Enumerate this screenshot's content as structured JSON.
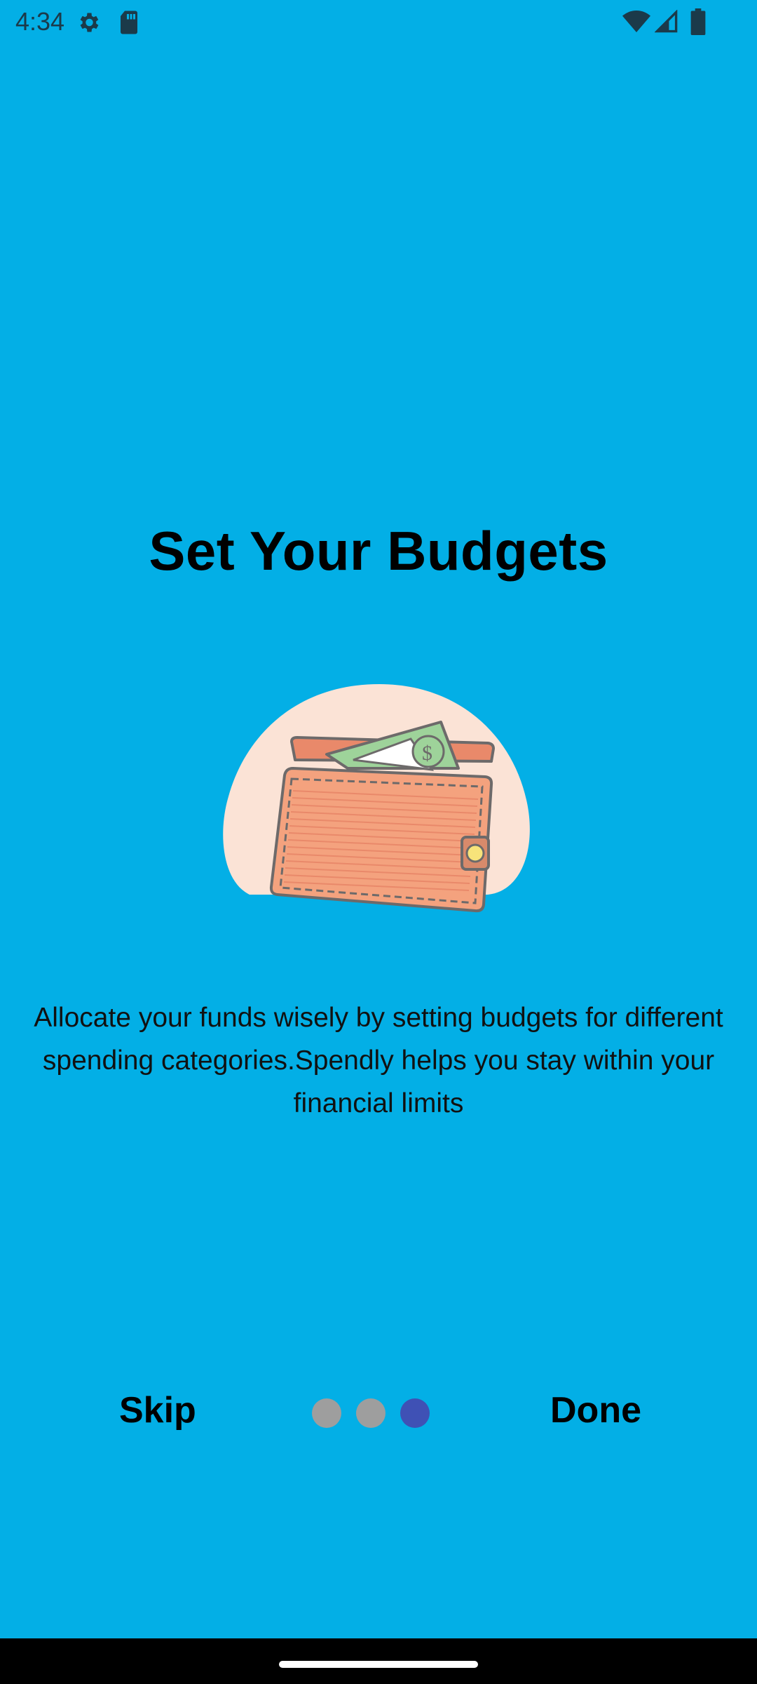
{
  "status_bar": {
    "time": "4:34",
    "icons": [
      "gear-icon",
      "sd-card-icon",
      "wifi-icon",
      "signal-icon",
      "battery-icon"
    ]
  },
  "onboarding": {
    "title": "Set Your Budgets",
    "description": "Allocate your funds wisely by setting budgets for different spending categories.Spendly helps you stay within your financial limits",
    "illustration": "wallet-with-money-icon",
    "page_index": 3,
    "page_count": 3
  },
  "controls": {
    "skip_label": "Skip",
    "done_label": "Done"
  },
  "colors": {
    "background": "#03AFE6",
    "dot_inactive": "#9E9E9E",
    "dot_active": "#3F51B5"
  }
}
